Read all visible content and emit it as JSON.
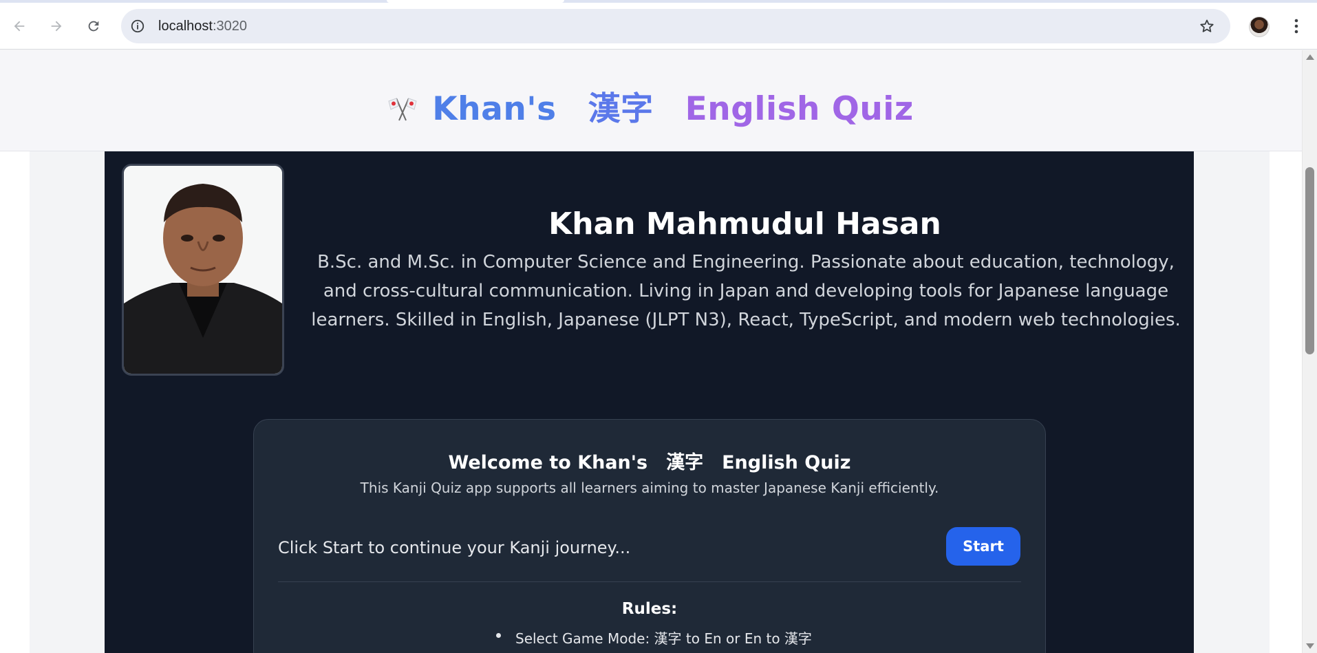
{
  "browser": {
    "url_host": "localhost",
    "url_port": ":3020"
  },
  "header": {
    "title_part1": "Khan's",
    "title_part2": "漢字",
    "title_part3": "English Quiz"
  },
  "profile": {
    "name": "Khan Mahmudul Hasan",
    "bio": "B.Sc. and M.Sc. in Computer Science and Engineering. Passionate about education, technology, and cross-cultural communication. Living in Japan and developing tools for Japanese language learners. Skilled in English, Japanese (JLPT N3), React, TypeScript, and modern web technologies."
  },
  "welcome": {
    "title": "Welcome to Khan's　漢字　English Quiz",
    "subtitle": "This Kanji Quiz app supports all learners aiming to master Japanese Kanji efficiently.",
    "prompt": "Click Start to continue your Kanji journey...",
    "start_label": "Start",
    "rules_title": "Rules:",
    "rules": [
      "Select Game Mode: 漢字 to En or En to 漢字"
    ]
  },
  "icons": {
    "back": "arrow-left-icon",
    "forward": "arrow-right-icon",
    "reload": "reload-icon",
    "info": "info-icon",
    "bookmark": "star-icon",
    "menu": "more-vert-icon",
    "flag": "crossed-flags-icon"
  },
  "colors": {
    "title_blue": "#4f7fe8",
    "title_purple": "#a066e6",
    "dark_bg": "#111827",
    "card_bg": "#1f2937",
    "start_button": "#2563eb"
  }
}
